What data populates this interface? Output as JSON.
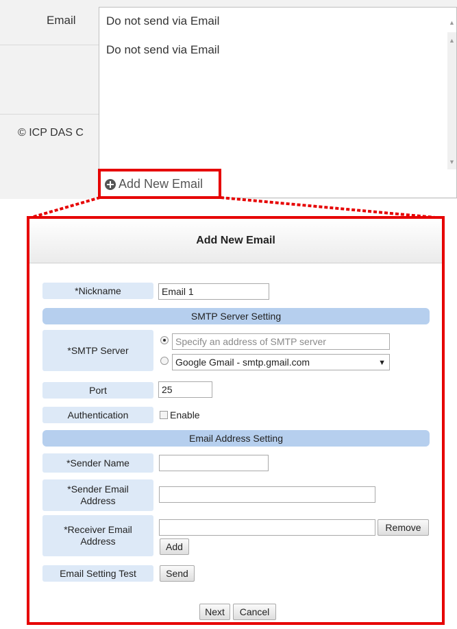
{
  "top": {
    "email_label": "Email",
    "select_value": "Do not send via Email",
    "options": [
      "Do not send via Email"
    ],
    "copyright": "© ICP DAS C",
    "add_new_link": "Add New Email"
  },
  "dialog": {
    "title": "Add New Email",
    "nickname_label": "*Nickname",
    "nickname_value": "Email 1",
    "smtp_section": "SMTP Server Setting",
    "smtp_server_label": "*SMTP Server",
    "smtp_address_placeholder": "Specify an address of SMTP server",
    "smtp_preset_value": "Google Gmail - smtp.gmail.com",
    "port_label": "Port",
    "port_value": "25",
    "auth_label": "Authentication",
    "auth_checkbox_label": "Enable",
    "email_section": "Email Address Setting",
    "sender_name_label": "*Sender Name",
    "sender_name_value": "",
    "sender_email_label": "*Sender Email Address",
    "sender_email_value": "",
    "receiver_email_label": "*Receiver Email Address",
    "receiver_email_value": "",
    "remove_button": "Remove",
    "add_button": "Add",
    "test_label": "Email Setting Test",
    "send_button": "Send",
    "next_button": "Next",
    "cancel_button": "Cancel"
  },
  "colors": {
    "highlight": "#e60000",
    "label_bg": "#dde9f7",
    "section_bg": "#b6cfee"
  }
}
